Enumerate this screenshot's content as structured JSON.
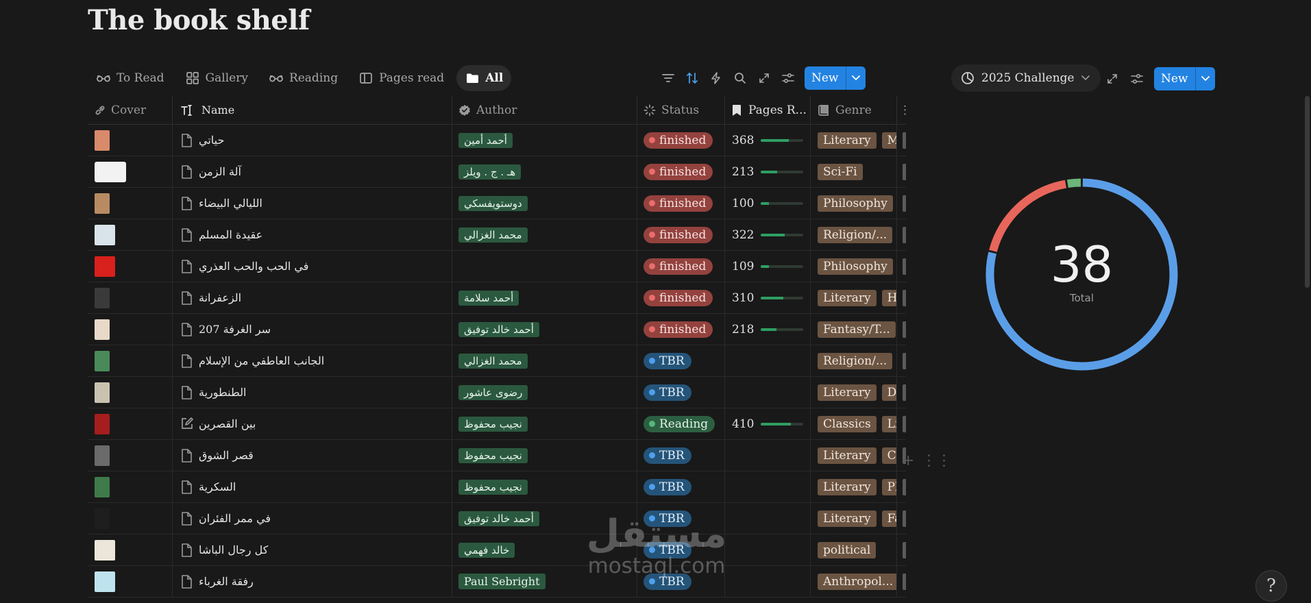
{
  "page": {
    "title": "The book shelf"
  },
  "tabs": [
    {
      "label": "To Read",
      "icon": "glasses-icon"
    },
    {
      "label": "Gallery",
      "icon": "gallery-icon"
    },
    {
      "label": "Reading",
      "icon": "glasses-icon"
    },
    {
      "label": "Pages read",
      "icon": "columns-icon"
    },
    {
      "label": "All",
      "icon": "folder-icon",
      "active": true
    }
  ],
  "toolbar": {
    "new_label": "New"
  },
  "columns": [
    {
      "label": "Cover",
      "icon": "link-icon"
    },
    {
      "label": "Name",
      "icon": "title-icon"
    },
    {
      "label": "Author",
      "icon": "verified-icon"
    },
    {
      "label": "Status",
      "icon": "status-icon"
    },
    {
      "label": "Pages R...",
      "icon": "bookmark-icon"
    },
    {
      "label": "Genre",
      "icon": "book-icon"
    }
  ],
  "rows": [
    {
      "name": "حياتي",
      "author": "أحمد أمين",
      "status": "finished",
      "pages": "368",
      "progress": 0.65,
      "genres": [
        "Literary",
        "Me"
      ],
      "cover": "#d98a6b"
    },
    {
      "name": "آلة الزمن",
      "author": "هـ . ج . ويلز",
      "status": "finished",
      "pages": "213",
      "progress": 0.38,
      "genres": [
        "Sci-Fi"
      ],
      "cover": "#f2f2f2"
    },
    {
      "name": "الليالي البيضاء",
      "author": "دوستويفسكي",
      "status": "finished",
      "pages": "100",
      "progress": 0.18,
      "genres": [
        "Philosophy",
        ""
      ],
      "cover": "#b88b62"
    },
    {
      "name": "عقيدة المسلم",
      "author": "محمد الغزالي",
      "status": "finished",
      "pages": "322",
      "progress": 0.55,
      "genres": [
        "Religion/..."
      ],
      "cover": "#d8e4ea"
    },
    {
      "name": "في الحب والحب العذري",
      "author": "",
      "status": "finished",
      "pages": "109",
      "progress": 0.18,
      "genres": [
        "Philosophy"
      ],
      "cover": "#d8201c"
    },
    {
      "name": "الزعفرانة",
      "author": "أحمد سلامة",
      "status": "finished",
      "pages": "310",
      "progress": 0.52,
      "genres": [
        "Literary",
        "His"
      ],
      "cover": "#3a3a3a"
    },
    {
      "name": "سر الغرفة 207",
      "author": "أحمد خالد توفيق",
      "status": "finished",
      "pages": "218",
      "progress": 0.37,
      "genres": [
        "Fantasy/T..."
      ],
      "cover": "#e8d9c8"
    },
    {
      "name": "الجانب العاطفي من الإسلام",
      "author": "محمد الغزالي",
      "status": "TBR",
      "pages": "",
      "progress": null,
      "genres": [
        "Religion/..."
      ],
      "cover": "#4a8a5a"
    },
    {
      "name": "الطنطورية",
      "author": "رضوى عاشور",
      "status": "TBR",
      "pages": "",
      "progress": null,
      "genres": [
        "Literary",
        "Dra"
      ],
      "cover": "#c9c2b0"
    },
    {
      "name": "بين القصرين",
      "author": "نجيب محفوظ",
      "status": "Reading",
      "pages": "410",
      "progress": 0.7,
      "genres": [
        "Classics",
        "Lite"
      ],
      "cover": "#a61d1d",
      "editing": true
    },
    {
      "name": "قصر الشوق",
      "author": "نجيب محفوظ",
      "status": "TBR",
      "pages": "",
      "progress": null,
      "genres": [
        "Literary",
        "Cla"
      ],
      "cover": "#6a6a6a"
    },
    {
      "name": "السكرية",
      "author": "نجيب محفوظ",
      "status": "TBR",
      "pages": "",
      "progress": null,
      "genres": [
        "Literary",
        "Phi"
      ],
      "cover": "#3e7a4a"
    },
    {
      "name": "في ممر الفئران",
      "author": "أحمد خالد توفيق",
      "status": "TBR",
      "pages": "",
      "progress": null,
      "genres": [
        "Literary",
        "Fan"
      ],
      "cover": "#1e1e1e"
    },
    {
      "name": "كل رجال الباشا",
      "author": "خالد فهمي",
      "status": "TBR",
      "pages": "",
      "progress": null,
      "genres": [
        "political"
      ],
      "cover": "#ece6da"
    },
    {
      "name": "رفقة الغرباء",
      "author": "Paul Sebright",
      "status": "TBR",
      "pages": "",
      "progress": null,
      "genres": [
        "Anthropol..."
      ],
      "cover": "#bfe3ee"
    }
  ],
  "challenge": {
    "label": "2025 Challenge",
    "new_label": "New",
    "total": "38",
    "total_label": "Total",
    "segments": [
      {
        "status": "TBR",
        "value": 30,
        "color": "#5b9ee8"
      },
      {
        "status": "finished",
        "value": 7,
        "color": "#e8665c"
      },
      {
        "status": "Reading",
        "value": 1,
        "color": "#6cb47a"
      }
    ]
  },
  "watermark": {
    "arabic": "مستقل",
    "latin": "mostaql.com"
  },
  "help": {
    "symbol": "?"
  }
}
